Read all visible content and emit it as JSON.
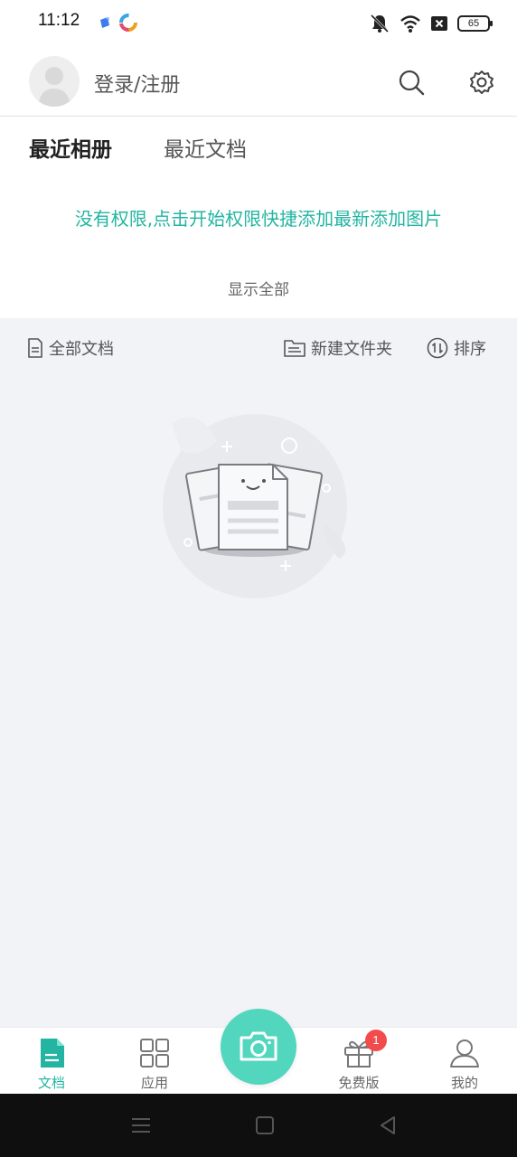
{
  "status_bar": {
    "time": "11:12",
    "battery": "65",
    "icons": [
      "app-icon-blue",
      "app-icon-colorful",
      "mute-bell-icon",
      "wifi-icon",
      "close-box-icon",
      "battery-icon"
    ]
  },
  "header": {
    "login_label": "登录/注册",
    "icons": [
      "avatar-icon",
      "search-icon",
      "gear-icon"
    ]
  },
  "tabs": [
    {
      "label": "最近相册",
      "active": true
    },
    {
      "label": "最近文档",
      "active": false
    }
  ],
  "album": {
    "permission_message": "没有权限,点击开始权限快捷添加最新添加图片",
    "show_all": "显示全部"
  },
  "doc_toolbar": {
    "all_docs": "全部文档",
    "new_folder": "新建文件夹",
    "sort": "排序"
  },
  "bottom_nav": {
    "items": [
      {
        "label": "文档",
        "icon": "document-icon",
        "active": true
      },
      {
        "label": "应用",
        "icon": "grid-icon",
        "active": false
      },
      {
        "label": "免费版",
        "icon": "gift-icon",
        "active": false,
        "badge": "1"
      },
      {
        "label": "我的",
        "icon": "person-icon",
        "active": false
      }
    ],
    "camera_icon": "camera-icon"
  },
  "colors": {
    "accent": "#23b5a2",
    "camera": "#52d6bd",
    "badge": "#f24b4b",
    "doc_background": "#f2f3f7"
  }
}
